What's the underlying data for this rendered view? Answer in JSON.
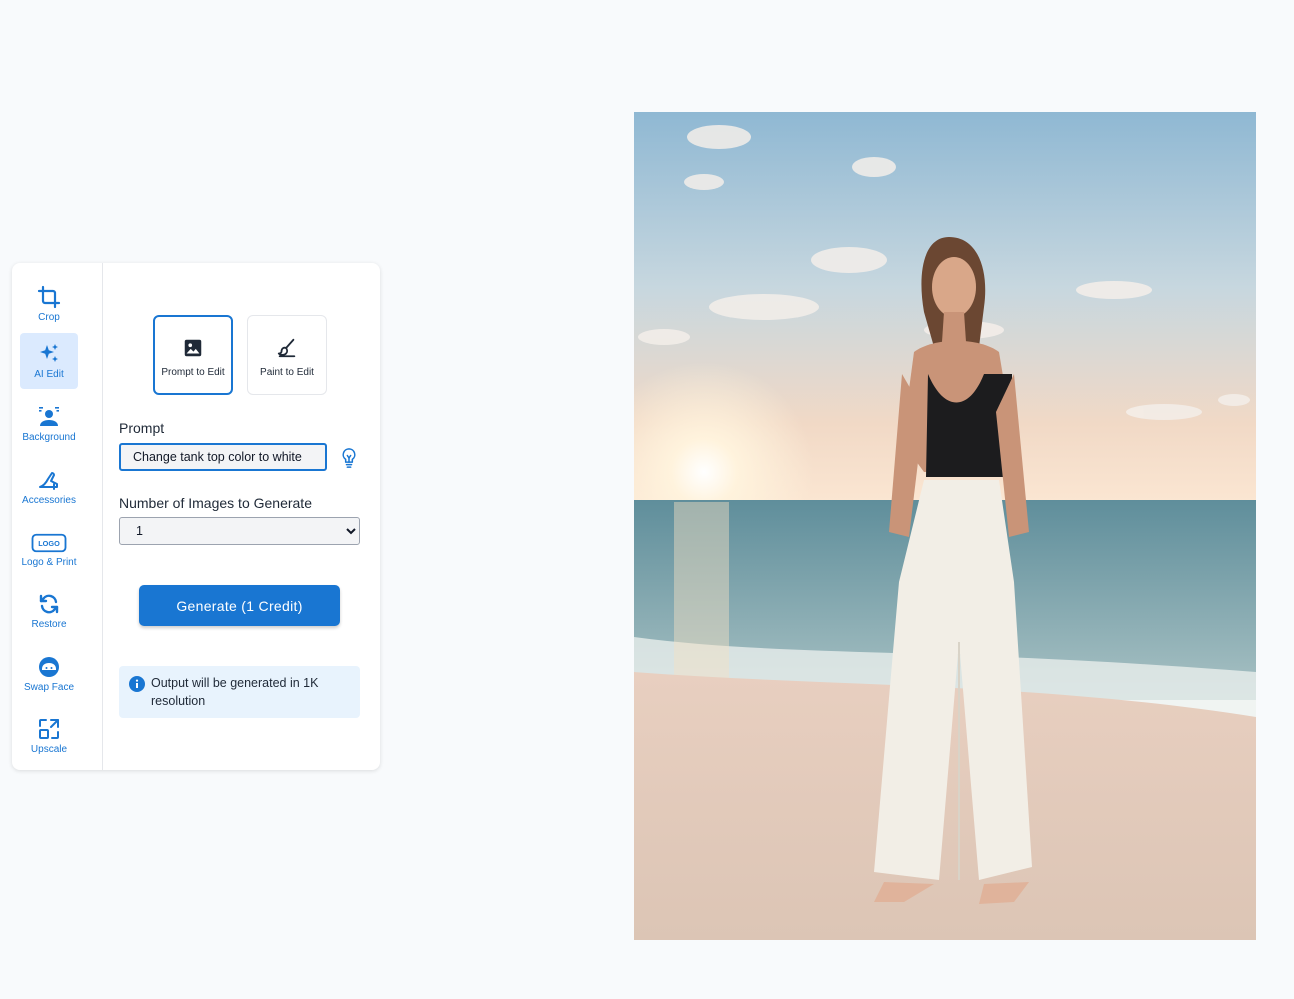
{
  "toolbar": {
    "tools": [
      {
        "label": "Crop",
        "icon": "crop-icon"
      },
      {
        "label": "AI Edit",
        "icon": "sparkles-icon",
        "active": true
      },
      {
        "label": "Background",
        "icon": "background-person-icon"
      },
      {
        "label": "Accessories",
        "icon": "high-heel-icon"
      },
      {
        "label": "Logo & Print",
        "icon": "logo-icon",
        "icon_text": "LOGO"
      },
      {
        "label": "Restore",
        "icon": "restore-icon"
      },
      {
        "label": "Swap Face",
        "icon": "face-icon"
      },
      {
        "label": "Upscale",
        "icon": "upscale-icon"
      }
    ]
  },
  "editor": {
    "modes": [
      {
        "label": "Prompt to Edit",
        "icon": "image-icon",
        "selected": true
      },
      {
        "label": "Paint to Edit",
        "icon": "brush-icon",
        "selected": false
      }
    ],
    "prompt_label": "Prompt",
    "prompt_value": "Change tank top color to white",
    "count_label": "Number of Images to Generate",
    "count_options": [
      "1"
    ],
    "generate_label": "Generate (1 Credit)",
    "info_text": "Output will be generated in 1K resolution"
  },
  "colors": {
    "accent": "#1976d2",
    "active_tool_bg": "#dbeafe",
    "info_bg": "#e8f3fd"
  }
}
